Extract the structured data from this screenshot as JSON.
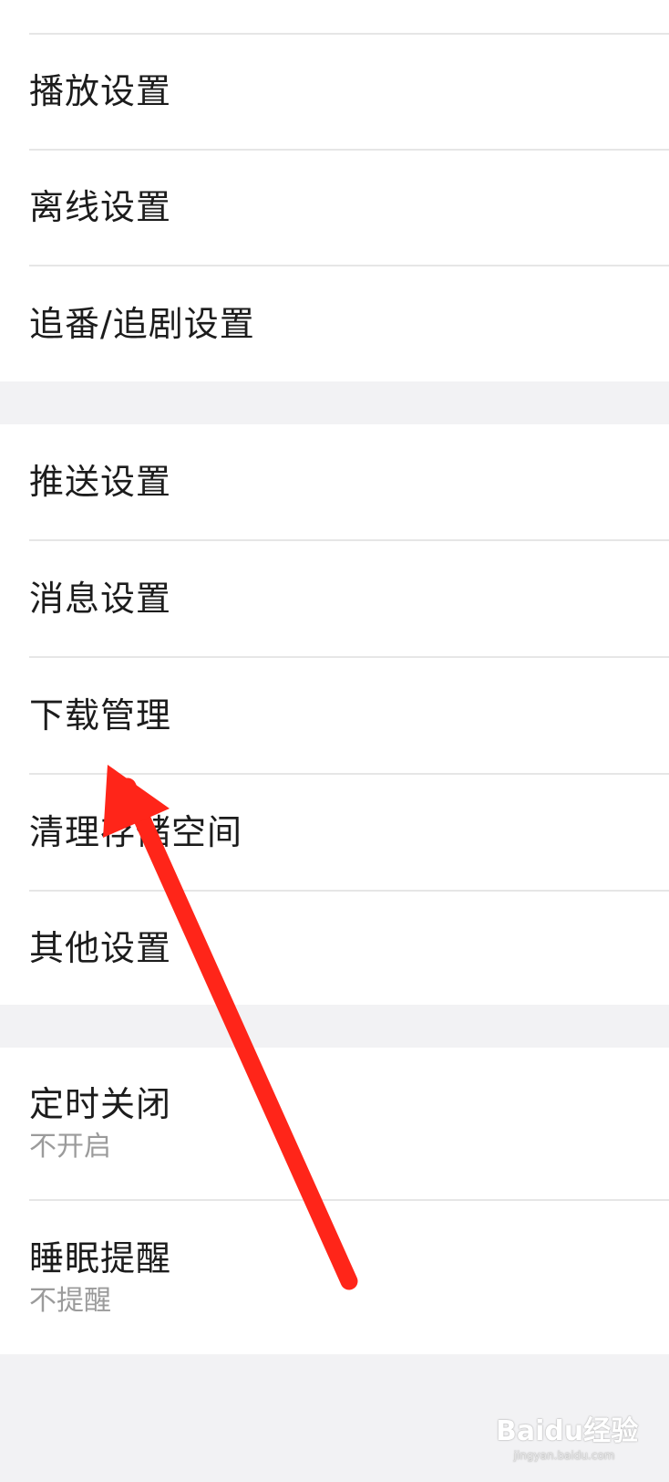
{
  "settings": {
    "group1": {
      "items": [
        {
          "label": "播放设置"
        },
        {
          "label": "离线设置"
        },
        {
          "label": "追番/追剧设置"
        }
      ]
    },
    "group2": {
      "items": [
        {
          "label": "推送设置"
        },
        {
          "label": "消息设置"
        },
        {
          "label": "下载管理"
        },
        {
          "label": "清理存储空间"
        },
        {
          "label": "其他设置"
        }
      ]
    },
    "group3": {
      "items": [
        {
          "label": "定时关闭",
          "value": "不开启"
        },
        {
          "label": "睡眠提醒",
          "value": "不提醒"
        }
      ]
    }
  },
  "annotation": {
    "arrow_color": "#ff2519",
    "target": "下载管理"
  },
  "watermark": {
    "logo": "Baidu经验",
    "url": "jingyan.baidu.com"
  }
}
